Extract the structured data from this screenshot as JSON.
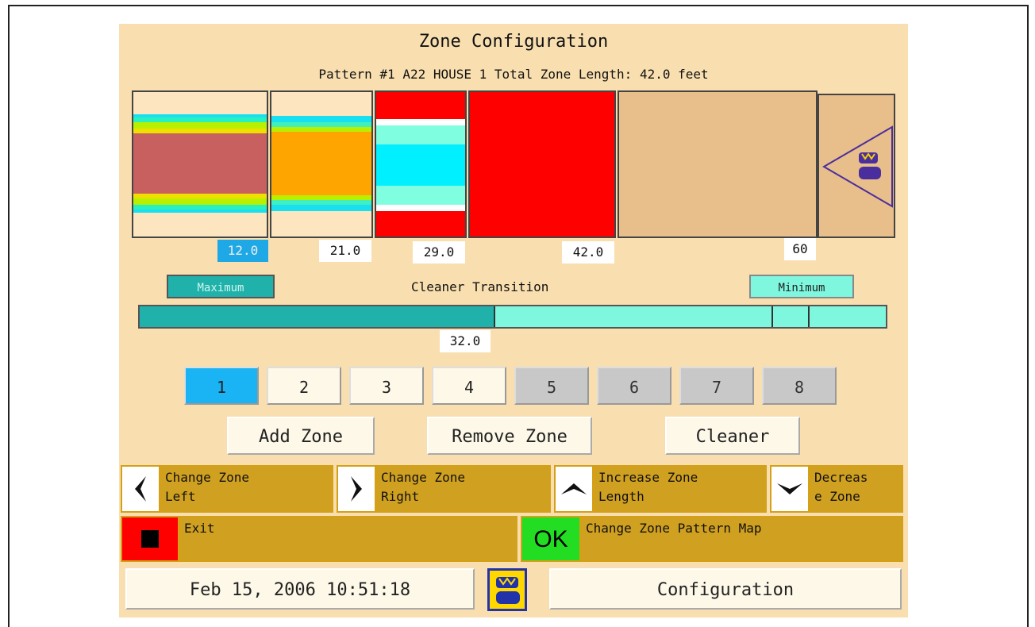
{
  "screen": {
    "title": "Zone Configuration",
    "subtitle": "Pattern #1 A22 HOUSE 1 Total Zone Length: 42.0 feet"
  },
  "zone_marks": [
    "12.0",
    "21.0",
    "29.0",
    "42.0",
    "60"
  ],
  "transition": {
    "label": "Cleaner Transition",
    "max_label": "Maximum",
    "min_label": "Minimum",
    "value": "32.0"
  },
  "zone_buttons": [
    "1",
    "2",
    "3",
    "4",
    "5",
    "6",
    "7",
    "8"
  ],
  "actions": {
    "add": "Add Zone",
    "remove": "Remove Zone",
    "cleaner": "Cleaner"
  },
  "keys": {
    "left": "Change Zone\nLeft",
    "right": "Change Zone\nRight",
    "increase": "Increase Zone\nLength",
    "decrease": "Decreas\ne Zone",
    "exit": "Exit",
    "ok_icon": "OK",
    "ok_text": "Change Zone Pattern Map"
  },
  "status": {
    "datetime": "Feb 15, 2006 10:51:18",
    "mode": "Configuration"
  },
  "colors": {
    "background": "#f9dfb0",
    "selected": "#1ab4f5",
    "teal": "#20b2aa",
    "aqua": "#7ff7df",
    "key_gold": "#d0a020"
  }
}
